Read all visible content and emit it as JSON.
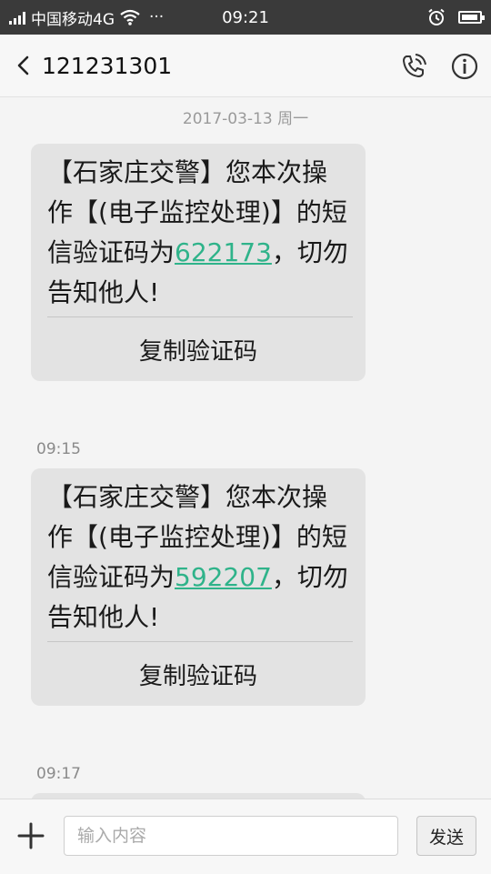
{
  "status_bar": {
    "carrier": "中国移动4G",
    "dots": "···",
    "time": "09:21",
    "icons": [
      "signal-icon",
      "wifi-icon",
      "alarm-icon",
      "battery-icon"
    ]
  },
  "header": {
    "title": "121231301",
    "icons": [
      "back-arrow-icon",
      "phone-call-icon",
      "info-icon"
    ]
  },
  "date_separator": "2017-03-13 周一",
  "messages": [
    {
      "text_before": "【石家庄交警】您本次操作【(电子监控处理)】的短信验证码为",
      "code": "622173",
      "text_after": "，切勿告知他人!",
      "copy_label": "复制验证码",
      "time": "09:15"
    },
    {
      "text_before": "【石家庄交警】您本次操作【(电子监控处理)】的短信验证码为",
      "code": "592207",
      "text_after": "，切勿告知他人!",
      "copy_label": "复制验证码",
      "time": "09:17"
    }
  ],
  "composer": {
    "placeholder": "输入内容",
    "send_label": "发送",
    "icons": [
      "plus-icon"
    ]
  },
  "colors": {
    "status_bar_bg": "#3a3a3a",
    "bubble_bg": "#e3e3e3",
    "code_link": "#2fb38a"
  }
}
